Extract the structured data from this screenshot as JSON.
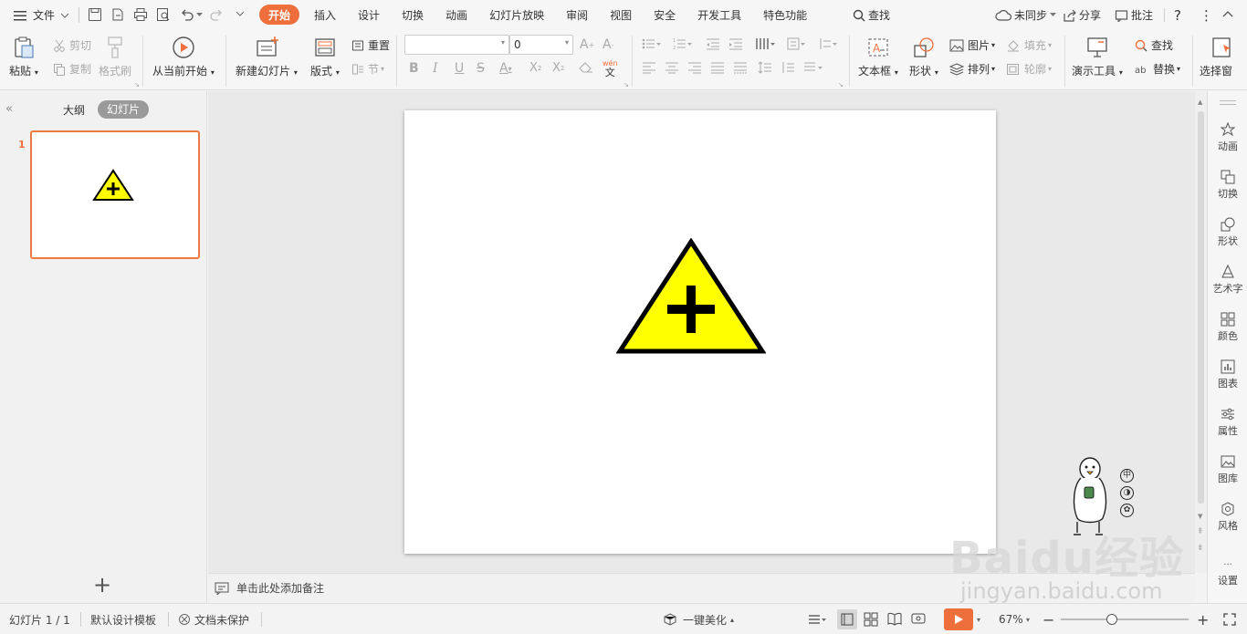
{
  "menu": {
    "file_label": "文件",
    "tabs": [
      {
        "label": "开始",
        "active": true
      },
      {
        "label": "插入"
      },
      {
        "label": "设计"
      },
      {
        "label": "切换"
      },
      {
        "label": "动画"
      },
      {
        "label": "幻灯片放映"
      },
      {
        "label": "审阅"
      },
      {
        "label": "视图"
      },
      {
        "label": "安全"
      },
      {
        "label": "开发工具"
      },
      {
        "label": "特色功能"
      }
    ],
    "search_label": "查找",
    "sync_label": "未同步",
    "share_label": "分享",
    "comment_label": "批注",
    "help_label": "?",
    "more_label": "⋮"
  },
  "ribbon": {
    "paste": "粘贴",
    "cut": "剪切",
    "copy": "复制",
    "format_painter": "格式刷",
    "from_current": "从当前开始",
    "new_slide": "新建幻灯片",
    "layout": "版式",
    "reset": "重置",
    "section": "节",
    "font_name": "",
    "font_size": "0",
    "textbox": "文本框",
    "shape": "形状",
    "picture": "图片",
    "fill": "填充",
    "arrange": "排列",
    "outline": "轮廓",
    "present_tools": "演示工具",
    "find": "查找",
    "replace": "替换",
    "select_pane": "选择窗"
  },
  "left_panel": {
    "outline_tab": "大纲",
    "slides_tab": "幻灯片",
    "slide_number": "1",
    "add": "+"
  },
  "notes": {
    "placeholder": "单击此处添加备注"
  },
  "right_panel": {
    "items": [
      "动画",
      "切换",
      "形状",
      "艺术字",
      "颜色",
      "图表",
      "属性",
      "图库",
      "风格"
    ],
    "settings": "设置"
  },
  "status": {
    "slide_info": "幻灯片 1 / 1",
    "template": "默认设计模板",
    "protection": "文档未保护",
    "beautify": "一键美化",
    "zoom": "67%",
    "zoom_level": 0.4
  },
  "watermark": {
    "brand": "Baidu经验",
    "url": "jingyan.baidu.com"
  },
  "colors": {
    "accent": "#ee6f3c",
    "triangle_fill": "#ffff00",
    "stroke": "#000000"
  }
}
